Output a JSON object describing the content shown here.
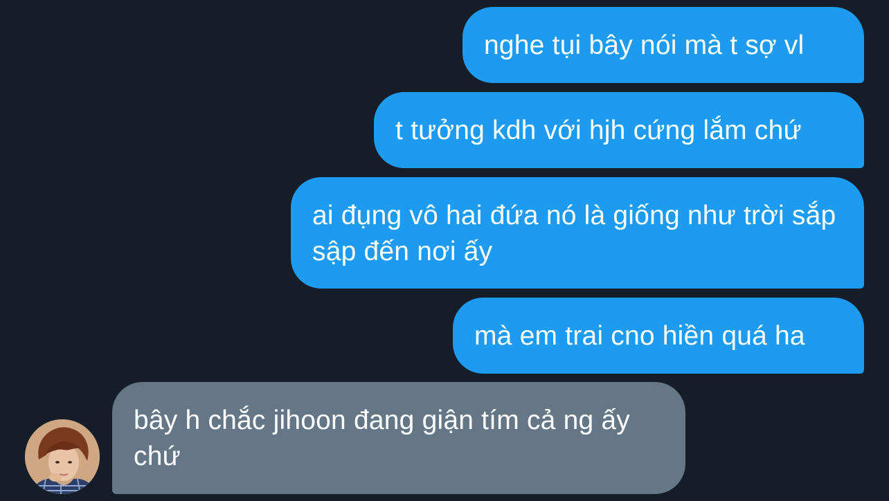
{
  "messages": [
    {
      "sender": "me",
      "text": "nghe tụi bây nói mà t sợ vl"
    },
    {
      "sender": "me",
      "text": "t tưởng kdh với hjh cứng lắm chứ"
    },
    {
      "sender": "me",
      "text": "ai đụng vô hai đứa nó là giống như trời sắp sập đến nơi ấy"
    },
    {
      "sender": "me",
      "text": "mà em trai cno hiền quá ha"
    },
    {
      "sender": "other",
      "text": "bây h chắc jihoon đang giận tím cả ng ấy chứ"
    }
  ],
  "colors": {
    "background": "#151e28",
    "outgoing_bubble": "#1d9bf0",
    "incoming_bubble": "#657786",
    "text": "#ffffff"
  },
  "avatar": {
    "icon": "user-avatar-photo"
  }
}
